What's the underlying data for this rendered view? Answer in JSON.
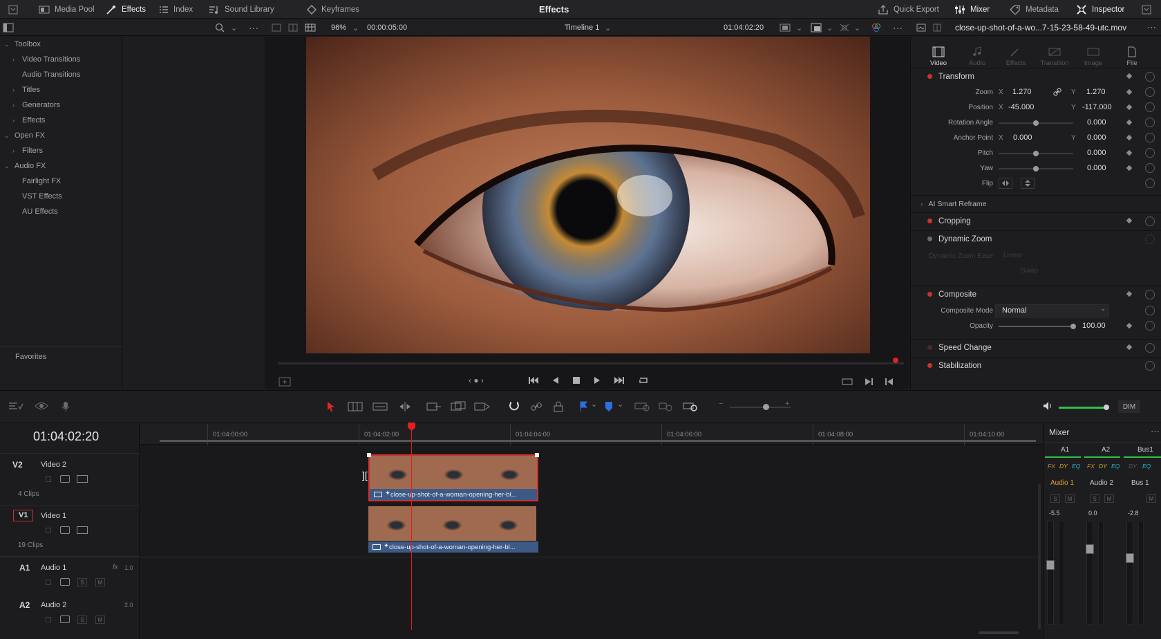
{
  "topbar": {
    "media_pool": "Media Pool",
    "effects": "Effects",
    "index": "Index",
    "sound_library": "Sound Library",
    "keyframes": "Keyframes",
    "title": "Effects",
    "quick_export": "Quick Export",
    "mixer": "Mixer",
    "metadata": "Metadata",
    "inspector": "Inspector"
  },
  "viewer_bar": {
    "zoom": "96%",
    "duration": "00:00:05:00",
    "timeline_name": "Timeline 1",
    "timecode": "01:04:02:20",
    "clip_name": "close-up-shot-of-a-wo...7-15-23-58-49-utc.mov"
  },
  "toolbox": {
    "items": [
      {
        "label": "Toolbox"
      },
      {
        "label": "Video Transitions"
      },
      {
        "label": "Audio Transitions"
      },
      {
        "label": "Titles"
      },
      {
        "label": "Generators"
      },
      {
        "label": "Effects"
      },
      {
        "label": "Open FX"
      },
      {
        "label": "Filters"
      },
      {
        "label": "Audio FX"
      },
      {
        "label": "Fairlight FX"
      },
      {
        "label": "VST Effects"
      },
      {
        "label": "AU Effects"
      }
    ],
    "favorites": "Favorites"
  },
  "inspector": {
    "tabs": [
      "Video",
      "Audio",
      "Effects",
      "Transition",
      "Image",
      "File"
    ],
    "transform": {
      "title": "Transform",
      "zoom_label": "Zoom",
      "zoom_x": "1.270",
      "zoom_y": "1.270",
      "position_label": "Position",
      "position_x": "-45.000",
      "position_y": "-117.000",
      "rotation_label": "Rotation Angle",
      "rotation": "0.000",
      "anchor_label": "Anchor Point",
      "anchor_x": "0.000",
      "anchor_y": "0.000",
      "pitch_label": "Pitch",
      "pitch": "0.000",
      "yaw_label": "Yaw",
      "yaw": "0.000",
      "flip_label": "Flip"
    },
    "axis_x": "X",
    "axis_y": "Y",
    "ai_reframe": "AI Smart Reframe",
    "cropping": "Cropping",
    "dynamic_zoom": "Dynamic Zoom",
    "dz_ease_label": "Dynamic Zoom Ease",
    "dz_ease_value": "Linear",
    "swap": "Swap",
    "composite": "Composite",
    "composite_mode_label": "Composite Mode",
    "composite_mode": "Normal",
    "opacity_label": "Opacity",
    "opacity": "100.00",
    "speed_change": "Speed Change",
    "stabilization": "Stabilization"
  },
  "timeline": {
    "timecode": "01:04:02:20",
    "ruler": [
      "01:04:00:00",
      "01:04:02:00",
      "01:04:04:00",
      "01:04:06:00",
      "01:04:08:00",
      "01:04:10:00"
    ],
    "tracks": [
      {
        "id": "V2",
        "name": "Video 2",
        "clips": "4 Clips"
      },
      {
        "id": "V1",
        "name": "Video 1",
        "clips": "19 Clips"
      },
      {
        "id": "A1",
        "name": "Audio 1",
        "level": "1.0",
        "fx": "fx"
      },
      {
        "id": "A2",
        "name": "Audio 2",
        "level": "2.0"
      }
    ],
    "clip_label_v2": "close-up-shot-of-a-woman-opening-her-bl...",
    "clip_label_v1": "close-up-shot-of-a-woman-opening-her-bl...",
    "solo": "S",
    "mute": "M"
  },
  "mixer": {
    "title": "Mixer",
    "channels": [
      "A1",
      "A2",
      "Bus1"
    ],
    "names": [
      "Audio 1",
      "Audio 2",
      "Bus 1"
    ],
    "levels": [
      "-5.5",
      "0.0",
      "-2.8"
    ],
    "fx_labels": [
      "FX",
      "DY",
      "EQ"
    ],
    "dim": "DIM"
  },
  "colors": {
    "accent_red": "#d0302f",
    "clip_blue": "#3d5a86",
    "playhead": "#e02020"
  }
}
